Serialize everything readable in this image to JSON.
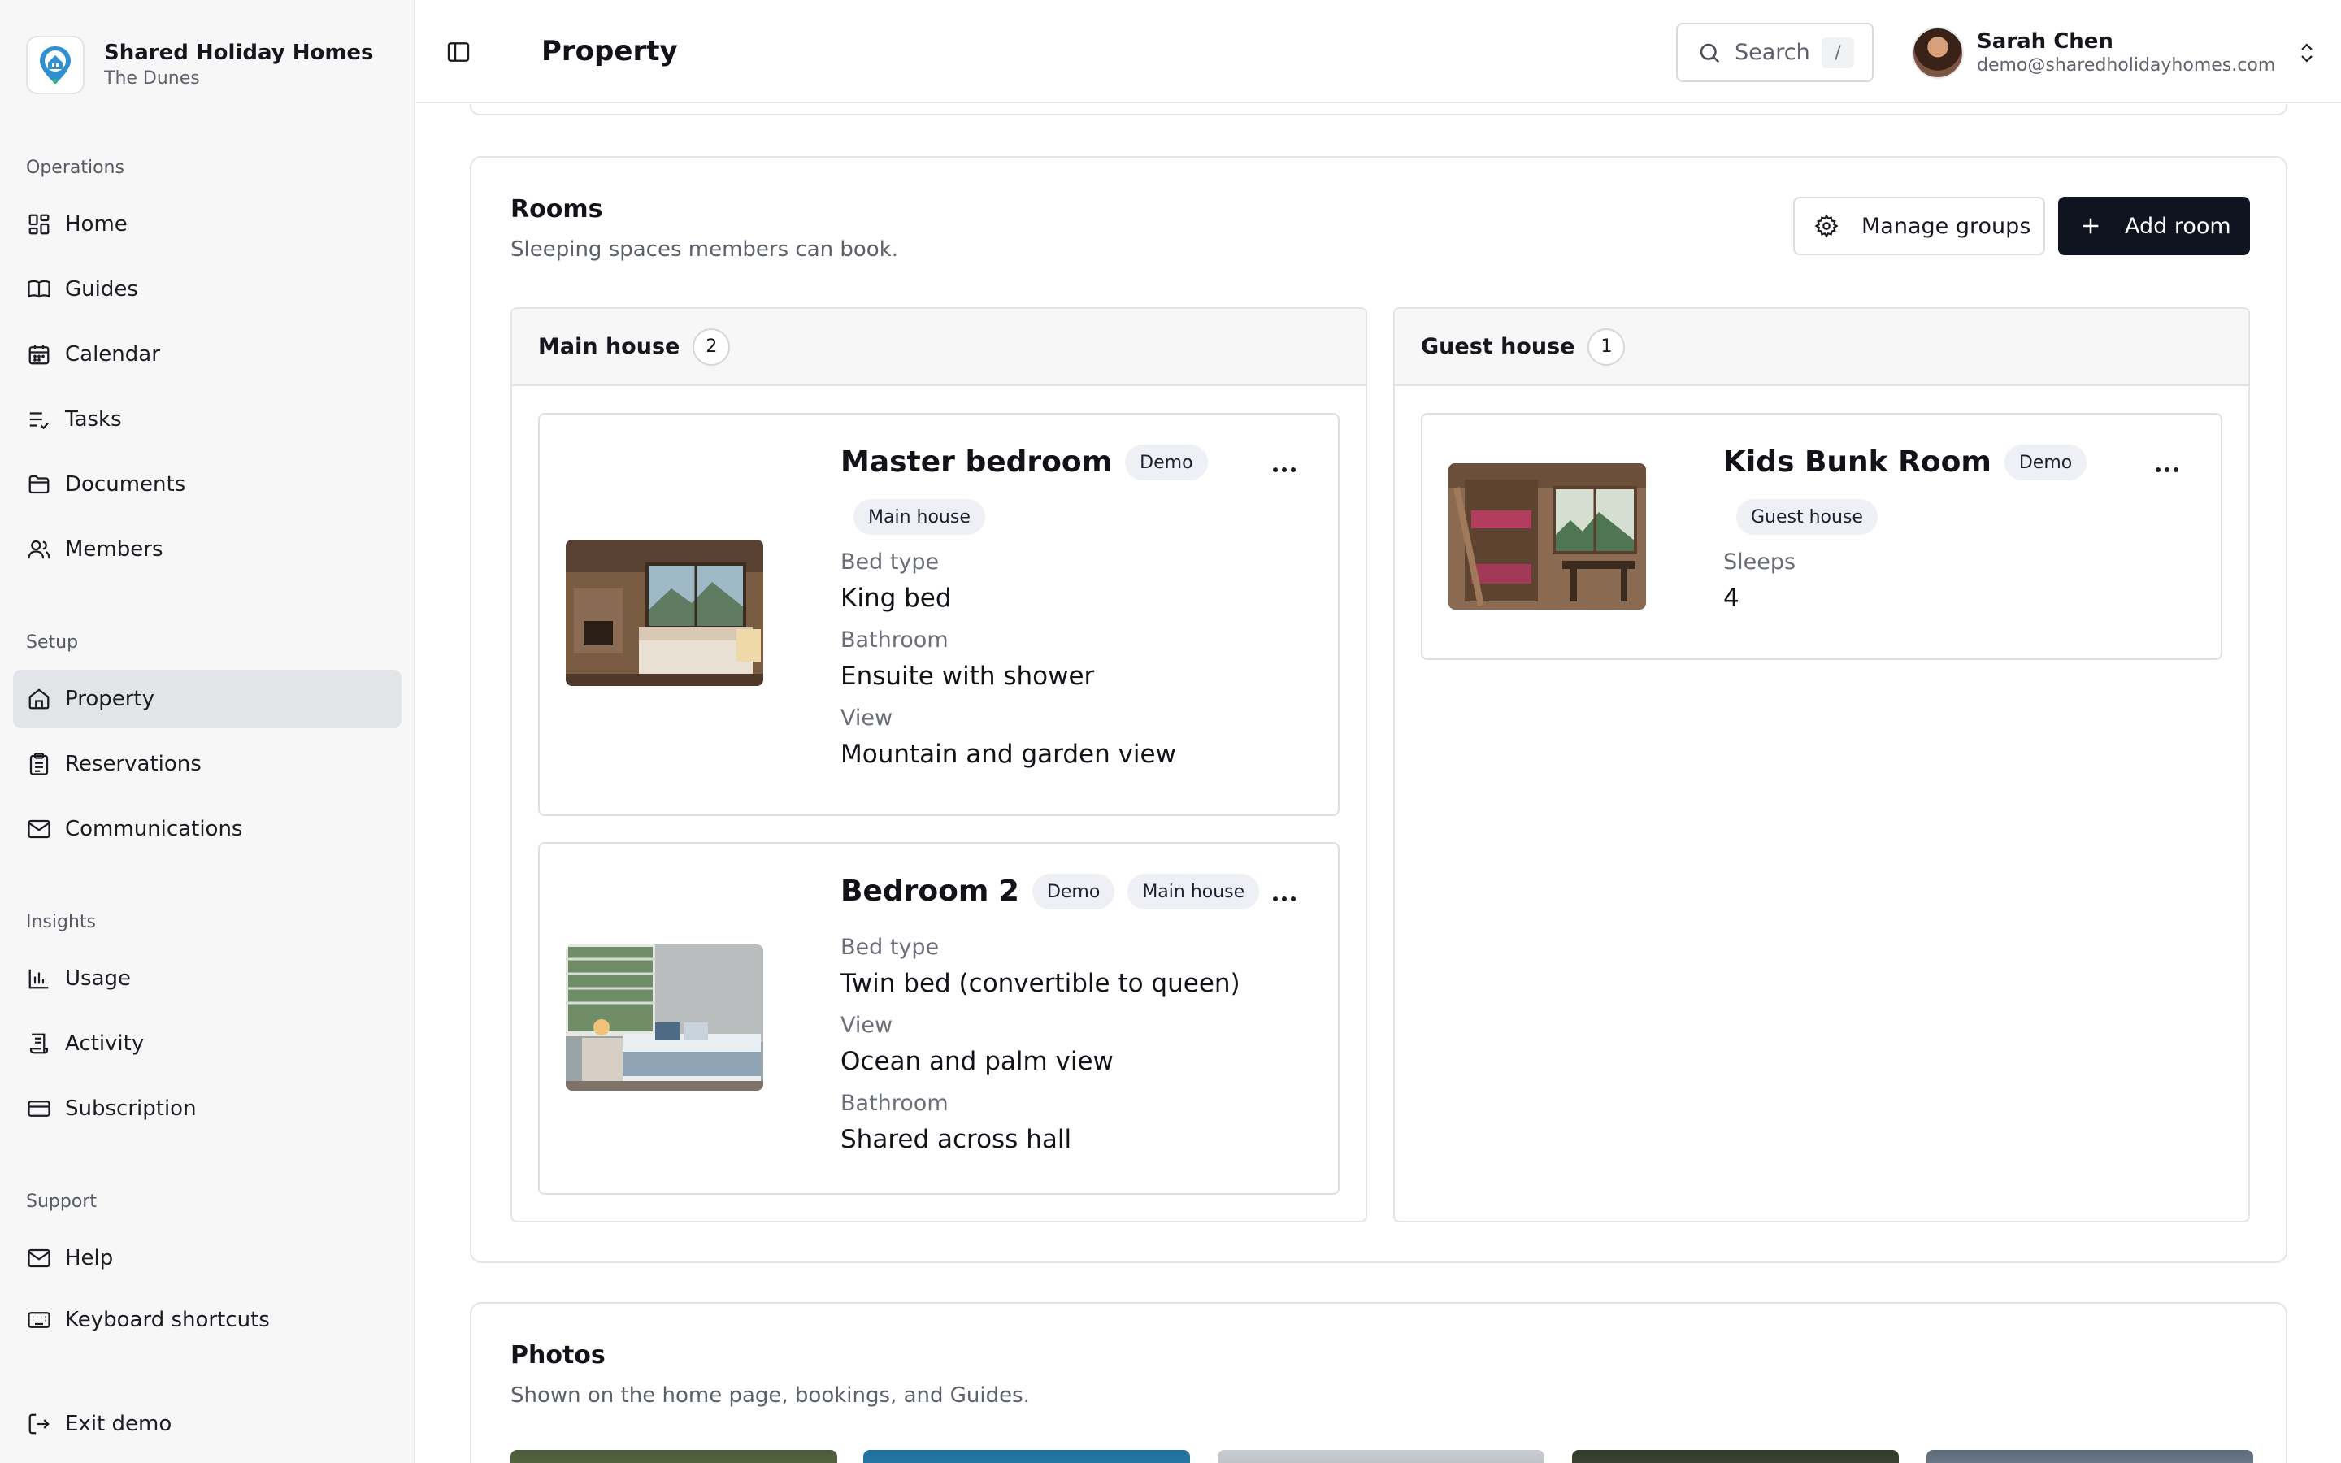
{
  "brand": {
    "name": "Shared Holiday Homes",
    "subtitle": "The Dunes"
  },
  "sidebar": {
    "groups": [
      {
        "label": "Operations",
        "items": [
          {
            "label": "Home",
            "icon": "dashboard-icon"
          },
          {
            "label": "Guides",
            "icon": "book-icon"
          },
          {
            "label": "Calendar",
            "icon": "calendar-icon"
          },
          {
            "label": "Tasks",
            "icon": "tasks-icon"
          },
          {
            "label": "Documents",
            "icon": "folder-icon"
          },
          {
            "label": "Members",
            "icon": "users-icon"
          }
        ]
      },
      {
        "label": "Setup",
        "items": [
          {
            "label": "Property",
            "icon": "house-icon",
            "active": true
          },
          {
            "label": "Reservations",
            "icon": "clipboard-icon"
          },
          {
            "label": "Communications",
            "icon": "mail-icon"
          }
        ]
      },
      {
        "label": "Insights",
        "items": [
          {
            "label": "Usage",
            "icon": "bar-chart-icon"
          },
          {
            "label": "Activity",
            "icon": "activity-log-icon"
          },
          {
            "label": "Subscription",
            "icon": "credit-card-icon"
          }
        ]
      },
      {
        "label": "Support",
        "items": [
          {
            "label": "Help",
            "icon": "mail-icon"
          },
          {
            "label": "Keyboard shortcuts",
            "icon": "keyboard-icon"
          }
        ]
      }
    ],
    "exit": {
      "label": "Exit demo",
      "icon": "logout-icon"
    }
  },
  "header": {
    "title": "Property",
    "search": {
      "label": "Search",
      "shortcut": "/"
    },
    "user": {
      "name": "Sarah Chen",
      "email": "demo@sharedholidayhomes.com"
    }
  },
  "rooms_section": {
    "title": "Rooms",
    "subtitle": "Sleeping spaces members can book.",
    "manage_groups_label": "Manage groups",
    "add_room_label": "Add room",
    "groups": [
      {
        "name": "Main house",
        "count": "2",
        "rooms": [
          {
            "name": "Master bedroom",
            "badge": "Demo",
            "group_tag": "Main house",
            "fields": [
              {
                "label": "Bed type",
                "value": "King bed"
              },
              {
                "label": "Bathroom",
                "value": "Ensuite with shower"
              },
              {
                "label": "View",
                "value": "Mountain and garden view"
              }
            ]
          },
          {
            "name": "Bedroom 2",
            "badge": "Demo",
            "group_tag": "Main house",
            "fields": [
              {
                "label": "Bed type",
                "value": "Twin bed (convertible to queen)"
              },
              {
                "label": "View",
                "value": "Ocean and palm view"
              },
              {
                "label": "Bathroom",
                "value": "Shared across hall"
              }
            ]
          }
        ]
      },
      {
        "name": "Guest house",
        "count": "1",
        "rooms": [
          {
            "name": "Kids Bunk Room",
            "badge": "Demo",
            "group_tag": "Guest house",
            "fields": [
              {
                "label": "Sleeps",
                "value": "4"
              }
            ]
          }
        ]
      }
    ]
  },
  "photos_section": {
    "title": "Photos",
    "subtitle": "Shown on the home page, bookings, and Guides."
  },
  "colors": {
    "primary_button": "#0f1420",
    "active_nav": "#e3e4e7",
    "pill_bg": "#eef0f5",
    "logo_accent": "#2f8fd0"
  }
}
